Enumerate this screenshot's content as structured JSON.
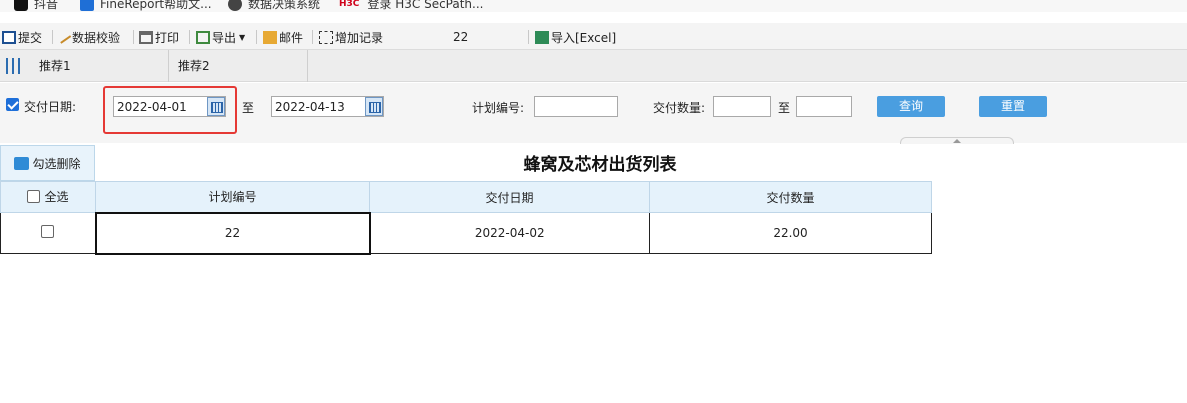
{
  "bookmarks": [
    {
      "label": "抖音",
      "icon": "tiktok-icon"
    },
    {
      "label": "FineReport帮助文...",
      "icon": "finereport-icon"
    },
    {
      "label": "数据决策系统",
      "icon": "globe-icon"
    },
    {
      "label": "登录 H3C SecPath...",
      "icon": "h3c-logo",
      "logo_text": "H3C"
    }
  ],
  "toolbar": {
    "submit": "提交",
    "validate": "数据校验",
    "print": "打印",
    "export": "导出",
    "email": "邮件",
    "add_record": "增加记录",
    "number": "22",
    "import_excel": "导入[Excel]"
  },
  "tabs": [
    "推荐1",
    "推荐2"
  ],
  "params": {
    "delivery_date_checked": true,
    "delivery_date_label": "交付日期:",
    "date_from": "2022-04-01",
    "to_label": "至",
    "date_to": "2022-04-13",
    "plan_no_label": "计划编号:",
    "plan_no_value": "",
    "qty_label": "交付数量:",
    "qty_from": "",
    "qty_to": "",
    "query_button": "查询",
    "reset_button": "重置"
  },
  "report": {
    "delete_button": "勾选删除",
    "title": "蜂窝及芯材出货列表",
    "select_all": "全选",
    "columns": [
      "计划编号",
      "交付日期",
      "交付数量"
    ],
    "rows": [
      {
        "checked": false,
        "plan_no": "22",
        "date": "2022-04-02",
        "qty": "22.00"
      }
    ]
  },
  "colors": {
    "accent": "#4a9ee0",
    "highlight_box": "#e53935",
    "header_bg": "#e5f2fb"
  }
}
